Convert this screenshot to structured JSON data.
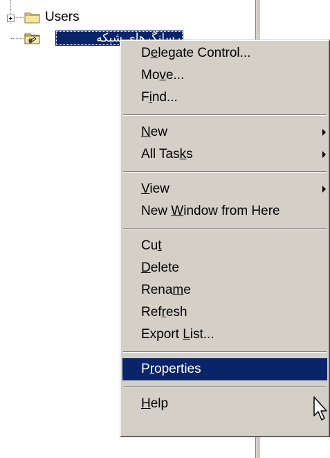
{
  "tree": {
    "users_node": {
      "label": "Users",
      "icon": "folder-icon",
      "expander": "plus"
    },
    "selected_node": {
      "label": "رسانگرهای شبکه",
      "icon": "ou-folder-icon"
    }
  },
  "context_menu": {
    "groups": [
      [
        {
          "pre": "D",
          "acc": "e",
          "post": "legate Control...",
          "submenu": false
        },
        {
          "pre": "Mo",
          "acc": "v",
          "post": "e...",
          "submenu": false
        },
        {
          "pre": "F",
          "acc": "i",
          "post": "nd...",
          "submenu": false
        }
      ],
      [
        {
          "pre": "",
          "acc": "N",
          "post": "ew",
          "submenu": true
        },
        {
          "pre": "All Tas",
          "acc": "k",
          "post": "s",
          "submenu": true
        }
      ],
      [
        {
          "pre": "",
          "acc": "V",
          "post": "iew",
          "submenu": true
        },
        {
          "pre": "New ",
          "acc": "W",
          "post": "indow from Here",
          "submenu": false
        }
      ],
      [
        {
          "pre": "Cu",
          "acc": "t",
          "post": "",
          "submenu": false
        },
        {
          "pre": "",
          "acc": "D",
          "post": "elete",
          "submenu": false
        },
        {
          "pre": "Rena",
          "acc": "m",
          "post": "e",
          "submenu": false
        },
        {
          "pre": "Ref",
          "acc": "r",
          "post": "esh",
          "submenu": false
        },
        {
          "pre": "Export ",
          "acc": "L",
          "post": "ist...",
          "submenu": false
        }
      ],
      [
        {
          "pre": "P",
          "acc": "r",
          "post": "operties",
          "submenu": false,
          "highlighted": true
        }
      ],
      [
        {
          "pre": "",
          "acc": "H",
          "post": "elp",
          "submenu": false
        }
      ]
    ]
  },
  "colors": {
    "selection": "#0a246a",
    "menu_face": "#d4d0c8",
    "folder": "#f2d580"
  }
}
